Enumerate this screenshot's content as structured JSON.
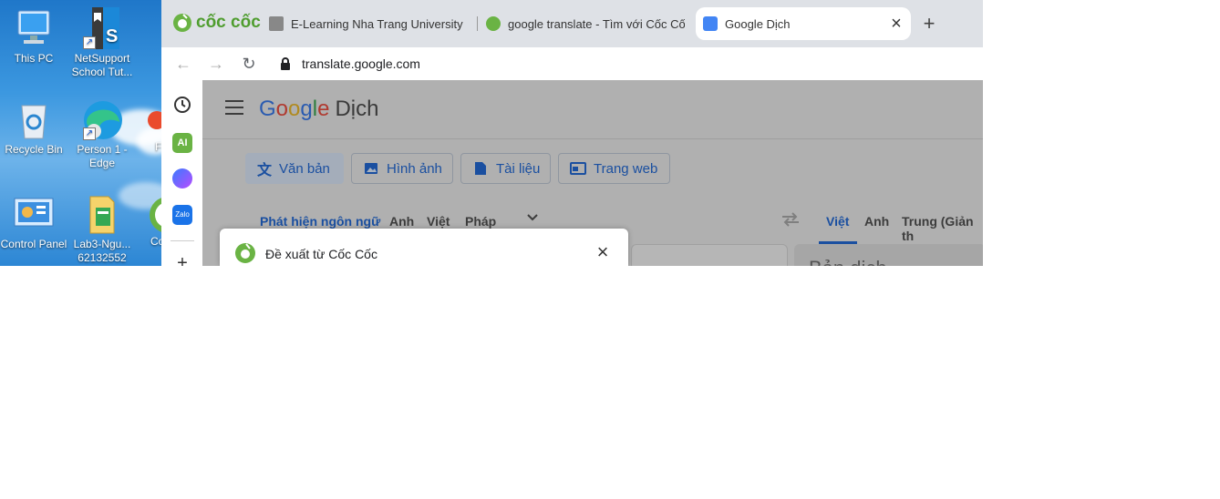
{
  "desktop": {
    "icons": [
      {
        "name": "this-pc-icon",
        "label": "This PC"
      },
      {
        "name": "netsupport-icon",
        "label": "NetSupport School Tut..."
      },
      {
        "name": "recycle-bin-icon",
        "label": "Recycle Bin"
      },
      {
        "name": "edge-icon",
        "label": "Person 1 - Edge"
      },
      {
        "name": "control-panel-icon",
        "label": "Control Panel"
      },
      {
        "name": "folder-icon",
        "label": "Lab3-Ngu... 62132552"
      },
      {
        "name": "partial-icon-f",
        "label": "F"
      },
      {
        "name": "partial-icon-co",
        "label": "Co"
      }
    ]
  },
  "browser": {
    "logo_text": "cốc cốc",
    "tabs": [
      {
        "label": "E-Learning Nha Trang University",
        "icon": "elearning-favicon"
      },
      {
        "label": "google translate - Tìm với Cốc Cốc",
        "icon": "coccoc-favicon"
      },
      {
        "label": "Google Dịch",
        "icon": "google-translate-favicon",
        "active": true
      }
    ],
    "new_tab": "+",
    "close_tab": "×",
    "url": "translate.google.com"
  },
  "sidebar": {
    "items": [
      {
        "name": "history-icon"
      },
      {
        "name": "ai-icon",
        "label": "AI"
      },
      {
        "name": "messenger-icon"
      },
      {
        "name": "zalo-icon",
        "label": "Zalo"
      }
    ],
    "add": "+"
  },
  "translate": {
    "logo_word": "Google",
    "product": "Dịch",
    "modes": [
      {
        "label": "Văn bản",
        "icon": "translate-icon",
        "selected": true
      },
      {
        "label": "Hình ảnh",
        "icon": "image-icon"
      },
      {
        "label": "Tài liệu",
        "icon": "document-icon"
      },
      {
        "label": "Trang web",
        "icon": "web-icon"
      }
    ],
    "source_langs": [
      "Phát hiện ngôn ngữ",
      "Anh",
      "Việt",
      "Pháp"
    ],
    "target_langs": [
      "Việt",
      "Anh",
      "Trung (Giản th"
    ],
    "translation_placeholder": "Bản dịch"
  },
  "popup": {
    "title": "Đề xuất từ Cốc Cốc",
    "close": "×"
  },
  "colors": {
    "accent": "#1a73e8",
    "coccoc_green": "#6ab344",
    "tab_bar": "#dee1e6"
  }
}
